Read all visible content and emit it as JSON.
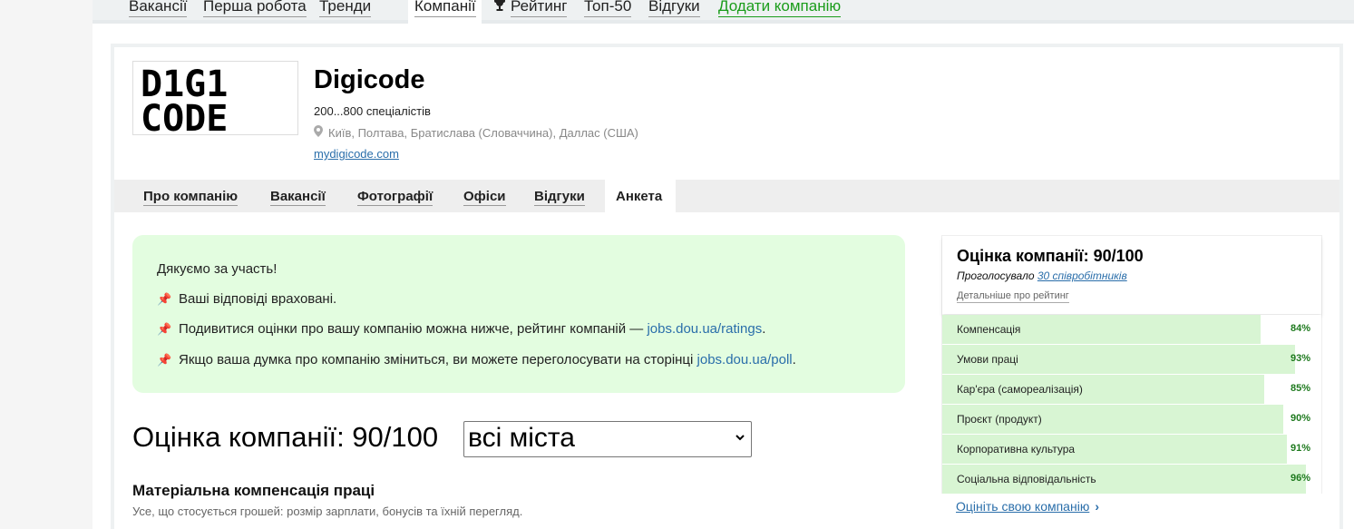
{
  "topnav": {
    "items": [
      "Вакансії",
      "Перша робота",
      "Тренди",
      "Компанії",
      "Рейтинг",
      "Топ-50",
      "Відгуки",
      "Додати компанію"
    ]
  },
  "company": {
    "name": "Digicode",
    "size": "200...800 спеціалістів",
    "locations": "Київ, Полтава, Братислава (Словаччина), Даллас (США)",
    "site": "mydigicode.com",
    "logo_text": [
      "D1G1",
      "CODE"
    ]
  },
  "subnav": {
    "items": [
      "Про компанію",
      "Вакансії",
      "Фотографії",
      "Офіси",
      "Відгуки",
      "Анкета"
    ]
  },
  "notice": {
    "thanks": "Дякуємо за участь!",
    "line1": "Ваші відповіді враховані.",
    "line2_text": "Подивитися оцінки про вашу компанію можна нижче, рейтинг компаній — ",
    "line2_link": "jobs.dou.ua/ratings",
    "line3_text": "Якщо ваша думка про компанію зміниться, ви можете переголосувати на сторінці ",
    "line3_link": "jobs.dou.ua/poll",
    "dot": "."
  },
  "main": {
    "rating_title": "Оцінка компанії: 90/100",
    "city_select": "всі міста",
    "section_title": "Матеріальна компенсація праці",
    "section_sub": "Усе, що стосується грошей: розмір зарплати, бонусів та їхній перегляд."
  },
  "sidebar": {
    "title": "Оцінка компанії: 90/100",
    "votes_prefix": "Проголосувало ",
    "votes_link": "30 співробітників",
    "more": "Детальніше про рейтинг",
    "rate_link": "Оцініть свою компанію",
    "bars": [
      {
        "label": "Компенсація",
        "pct_text": "84%",
        "value": 84
      },
      {
        "label": "Умови праці",
        "pct_text": "93%",
        "value": 93
      },
      {
        "label": "Кар'єра (самореалізація)",
        "pct_text": "85%",
        "value": 85
      },
      {
        "label": "Проєкт (продукт)",
        "pct_text": "90%",
        "value": 90
      },
      {
        "label": "Корпоративна культура",
        "pct_text": "91%",
        "value": 91
      },
      {
        "label": "Соціальна відповідальність",
        "pct_text": "96%",
        "value": 96
      }
    ]
  },
  "colors": {
    "bar_fill": "#d8f5d3",
    "notice_bg": "#e3fde0",
    "link": "#2a6eaa",
    "green_link": "#1a9c1a"
  },
  "icons": {
    "pin": "map-pin-icon",
    "pushpin": "pushpin-icon",
    "trophy": "trophy-icon",
    "chevron": "chevron-right-icon",
    "dropdown": "chevron-down-icon"
  }
}
